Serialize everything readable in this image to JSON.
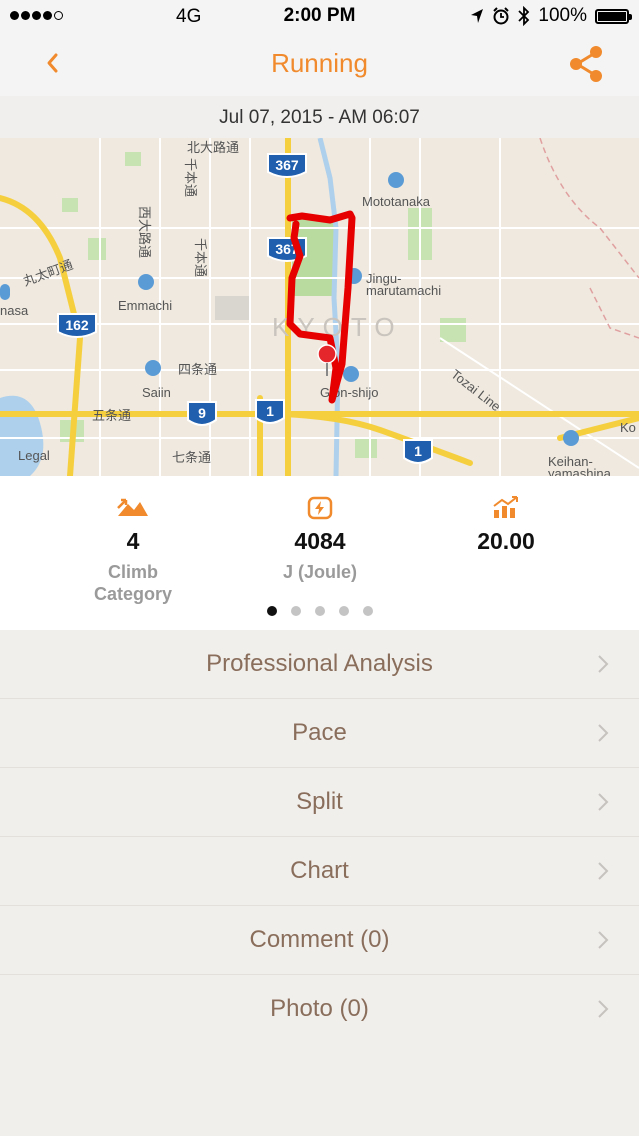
{
  "status_bar": {
    "carrier": "4G",
    "time": "2:00 PM",
    "battery": "100%"
  },
  "nav": {
    "title": "Running",
    "accent_color": "#f08a2c"
  },
  "date": "Jul 07, 2015 - AM 06:07",
  "map": {
    "city_label": "KYOTO",
    "places": [
      "北大路通",
      "Mototanaka",
      "西大路通",
      "千本通",
      "千本通",
      "Jingu-marutamachi",
      "丸太町通",
      "Emmachi",
      "Saiin",
      "四条通",
      "Gion-shijo",
      "五条通",
      "七条通",
      "Legal",
      "Keihan-yamashina",
      "Tozai Line"
    ],
    "labels": {
      "kitaoji": "北大路通",
      "mototanaka": "Mototanaka",
      "nishioji": "西大路通",
      "senbon_a": "千本通",
      "senbon_b": "千本通",
      "jingu_a": "Jingu-",
      "jingu_b": "marutamachi",
      "marutamachi": "丸太町通",
      "emmachi": "Emmachi",
      "nasa": "nasa",
      "saiin": "Saiin",
      "shijo": "四条通",
      "gion": "Gion-shijo",
      "gojo": "五条通",
      "shichijo": "七条通",
      "legal": "Legal",
      "keihan_a": "Keihan-",
      "keihan_b": "yamashina",
      "tozai": "Tozai Line",
      "ko": "Ko"
    },
    "route_shields": [
      "367",
      "367",
      "162",
      "9",
      "1",
      "1"
    ]
  },
  "stats": [
    {
      "icon": "climb-icon",
      "value": "4",
      "label": "Climb Category"
    },
    {
      "icon": "energy-icon",
      "value": "4084",
      "label": "J (Joule)"
    },
    {
      "icon": "graph-icon",
      "value": "20.00",
      "label": ""
    }
  ],
  "pager": {
    "count": 5,
    "active": 1
  },
  "menu": [
    {
      "label": "Professional Analysis"
    },
    {
      "label": "Pace"
    },
    {
      "label": "Split"
    },
    {
      "label": "Chart"
    },
    {
      "label": "Comment (0)"
    },
    {
      "label": "Photo (0)"
    }
  ]
}
